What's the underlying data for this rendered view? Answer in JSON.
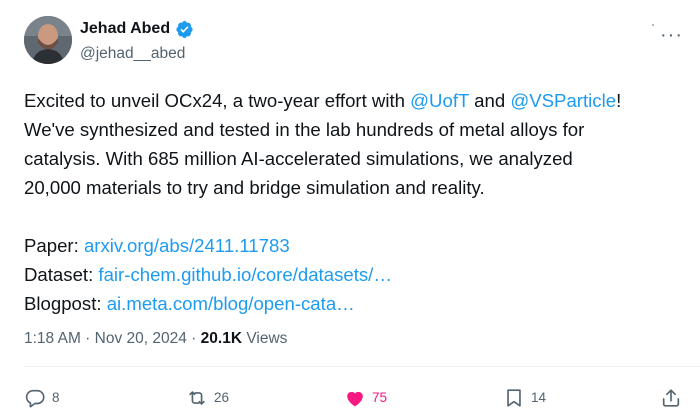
{
  "author": {
    "name": "Jehad Abed",
    "handle": "@jehad__abed",
    "verified_icon": "verified-badge",
    "badge_color": "#1d9bf0"
  },
  "tweet": {
    "intro": "Excited to unveil OCx24, a two-year effort with ",
    "mention1": "@UofT",
    "and": " and ",
    "mention2": "@VSParticle",
    "intro_end": "!",
    "line2": "We've synthesized and tested in the lab hundreds of metal alloys for",
    "line3": "catalysis. With 685 million AI-accelerated simulations, we analyzed",
    "line4": "20,000 materials to try and bridge simulation and reality.",
    "paper_label": "Paper: ",
    "paper_link": "arxiv.org/abs/2411.11783",
    "dataset_label": "Dataset: ",
    "dataset_link": "fair-chem.github.io/core/datasets/…",
    "blog_label": "Blogpost: ",
    "blog_link": "ai.meta.com/blog/open-cata…"
  },
  "meta": {
    "time": "1:18 AM",
    "sep1": " · ",
    "date": "Nov 20, 2024",
    "sep2": " · ",
    "views": "20.1K",
    "views_label": " Views"
  },
  "actions": {
    "replies": "8",
    "reposts": "26",
    "likes": "75",
    "bookmarks": "14"
  },
  "colors": {
    "link": "#1d9bf0",
    "like": "#f91880",
    "secondary_text": "#536471"
  }
}
